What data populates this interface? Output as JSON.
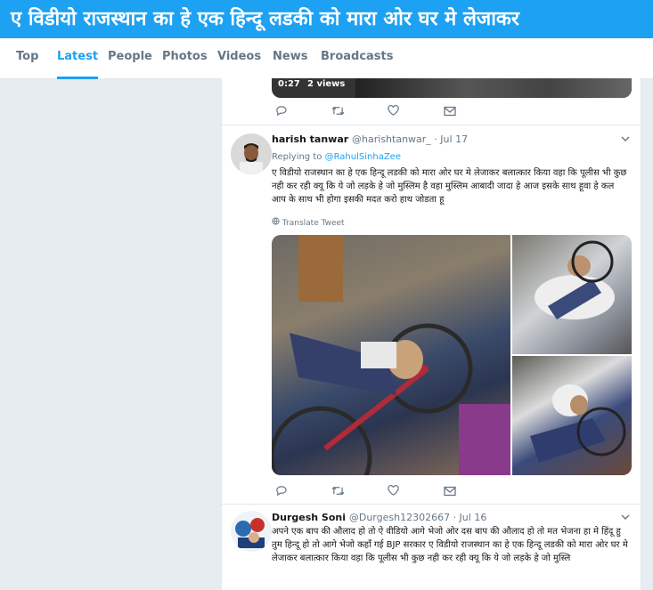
{
  "header": {
    "title": "ए विडीयो राजस्थान का हे एक हिन्दू लडकी को मारा ओर घर मे लेजाकर"
  },
  "nav": {
    "tabs": [
      {
        "label": "Top"
      },
      {
        "label": "Latest",
        "active": true
      },
      {
        "label": "People"
      },
      {
        "label": "Photos"
      },
      {
        "label": "Videos"
      },
      {
        "label": "News"
      },
      {
        "label": "Broadcasts"
      }
    ]
  },
  "video": {
    "duration": "0:27",
    "views": "2 views"
  },
  "tweets": [
    {
      "name": "harish tanwar",
      "handle": "@harishtanwar_ · Jul 17",
      "replying_prefix": "Replying to",
      "replying_to": "@RahulSinhaZee",
      "text": "ए विडीयो राजस्थान का हे एक हिन्दू लडकी को मारा ओर घर मे लेजाकर बलात्कार किया वहा कि पूलीस भी कुछ नही कर रही क्यू कि ये जो लड़के हे जो मुस्लिम है वहा मुस्लिम आबादी जादा हे आज इसके साथ हूवा हे कल आप के साथ भी होगा इसकी मदत करो हाथ जोडता हू",
      "translate": "Translate Tweet"
    },
    {
      "name": "Durgesh Soni",
      "handle": "@Durgesh12302667 · Jul 16",
      "text": "अपने एक बाप की औलाद हो तो ऐ वीडियो आगे भेजो ओर दस बाप की औलाद हो तो मत भेजना हा मे हिंदू हु तुम हिन्दू हो तो आगे भेजो कहाँ गई BJP सरकार ए विडीयो राजस्थान का हे एक हिन्दू लडकी को मारा ओर घर मे लेजाकर बलात्कार किया वहा कि पूलीस भी कुछ नही कर रही क्यू कि ये जो लड़के हे जो मुस्लि"
    }
  ],
  "icons": {
    "reply": "reply-icon",
    "retweet": "retweet-icon",
    "like": "heart-icon",
    "dm": "envelope-icon",
    "caret": "chevron-down-icon"
  },
  "colors": {
    "brand": "#1da1f2",
    "muted": "#657786"
  }
}
